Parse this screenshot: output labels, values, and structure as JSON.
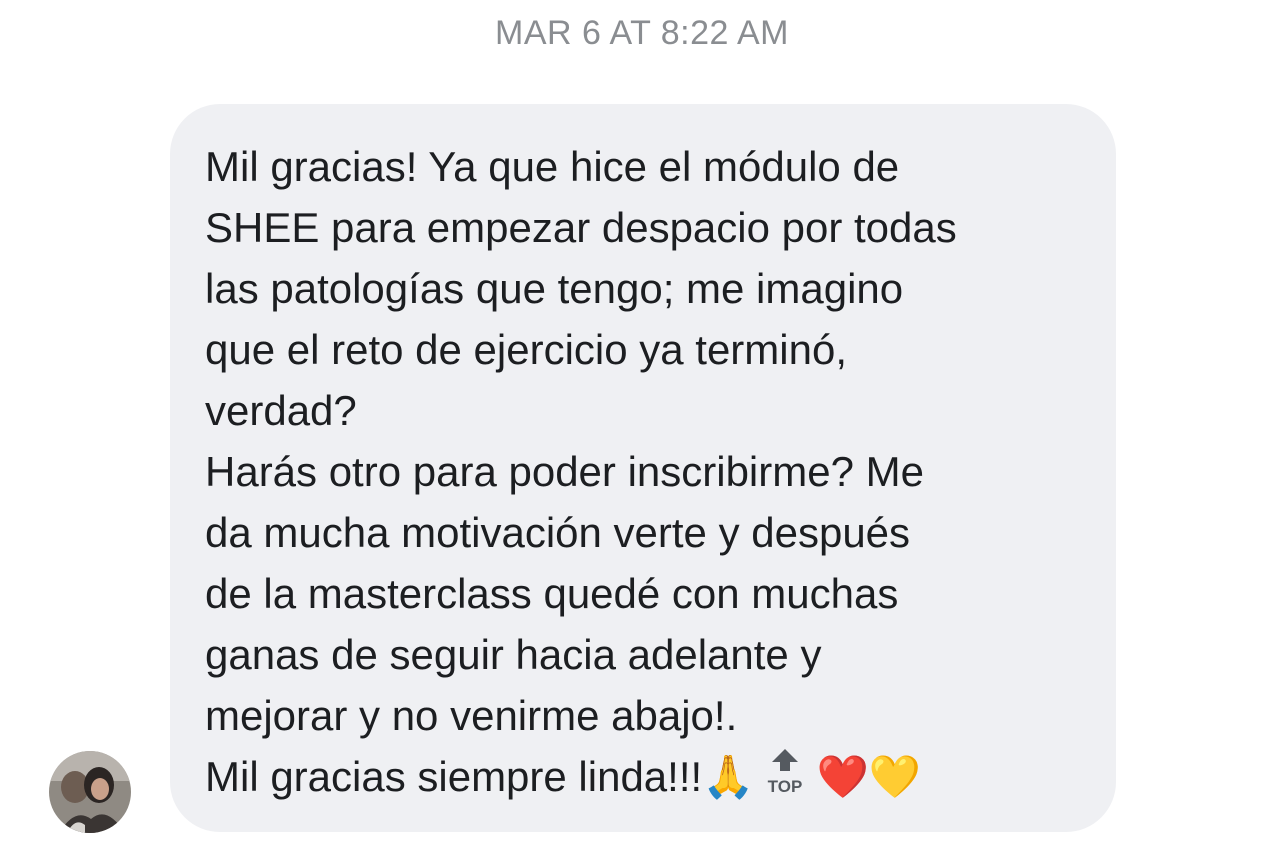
{
  "thread": {
    "timestamp": "MAR 6 AT 8:22 AM"
  },
  "message": {
    "lines": [
      "Mil gracias! Ya que hice el módulo de",
      "SHEE para empezar despacio por todas",
      "las patologías que tengo; me imagino",
      "que el reto de ejercicio ya terminó,",
      "verdad?",
      "Harás otro para poder inscribirme? Me",
      "da mucha motivación verte y después",
      "de la masterclass quedé con muchas",
      "ganas de seguir hacia adelante y",
      "mejorar y no venirme abajo!."
    ],
    "last_line_text": "Mil gracias siempre linda!!!",
    "emojis": {
      "pray": "🙏",
      "top": "🔝",
      "red_heart": "❤️",
      "yellow_heart": "💛"
    },
    "top_emoji_label": "TOP"
  },
  "sender": {
    "avatar_icon": "user-avatar-photo"
  },
  "colors": {
    "bubble_background": "#eff0f3",
    "message_text": "#1c1e21",
    "timestamp_text": "#8a8d91"
  }
}
